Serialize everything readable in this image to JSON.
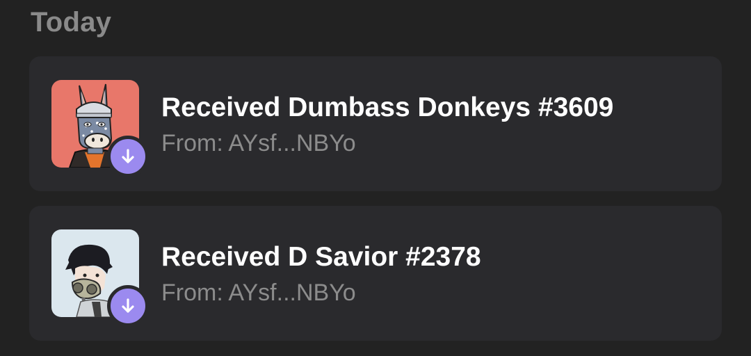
{
  "section": {
    "title": "Today"
  },
  "activity": [
    {
      "title": "Received Dumbass Donkeys #3609",
      "from": "From: AYsf...NBYo",
      "thumbnail_icon": "donkey-nft-thumbnail",
      "badge_icon": "arrow-down-icon"
    },
    {
      "title": "Received D Savior #2378",
      "from": "From: AYsf...NBYo",
      "thumbnail_icon": "savior-nft-thumbnail",
      "badge_icon": "arrow-down-icon"
    }
  ],
  "colors": {
    "background": "#222222",
    "card": "#2a2a2d",
    "badge": "#9b8aef",
    "title_text": "#ffffff",
    "secondary_text": "#8c8c8c"
  }
}
